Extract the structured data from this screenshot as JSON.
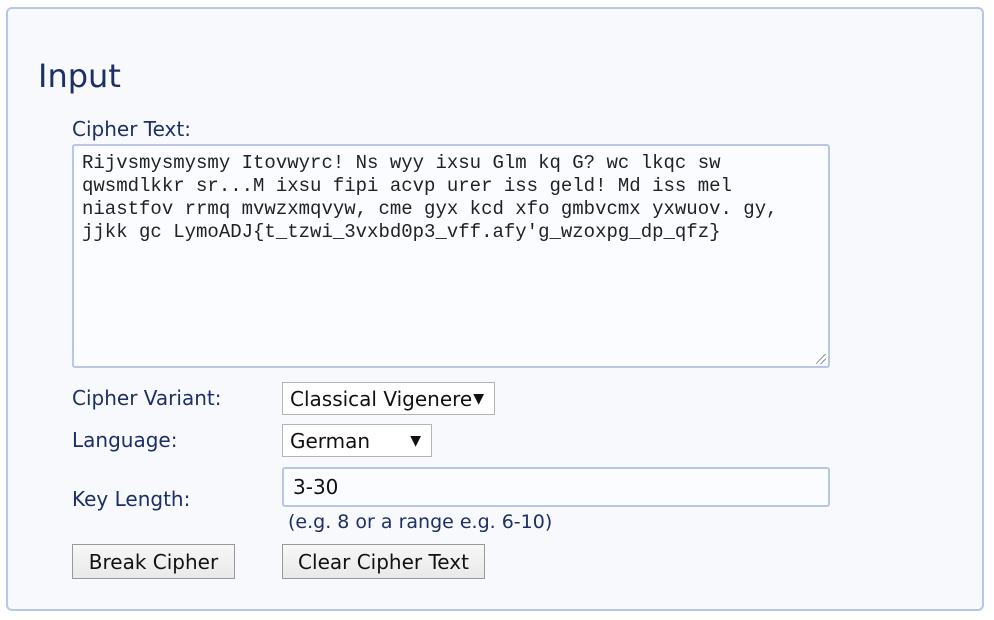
{
  "section": {
    "title": "Input"
  },
  "cipher_text": {
    "label": "Cipher Text:",
    "value": "Rijvsmysmysmy Itovwyrc! Ns wyy ixsu Glm kq G? wc lkqc sw qwsmdlkkr sr...M ixsu fipi acvp urer iss geld! Md iss mel niastfov rrmq mvwzxmqvyw, cme gyx kcd xfo gmbvcmx yxwuov. gy, jjkk gc LymoADJ{t_tzwi_3vxbd0p3_vff.afy'g_wzoxpg_dp_qfz}"
  },
  "cipher_variant": {
    "label": "Cipher Variant:",
    "selected": "Classical Vigenere"
  },
  "language": {
    "label": "Language:",
    "selected": "German"
  },
  "key_length": {
    "label": "Key Length:",
    "value": "3-30",
    "hint": "(e.g. 8 or a range e.g. 6-10)"
  },
  "buttons": {
    "break": "Break Cipher",
    "clear": "Clear Cipher Text"
  },
  "icons": {
    "select_arrow": "triangle-down-icon",
    "resize": "resize-grip-icon"
  },
  "colors": {
    "label": "#1c2f66",
    "border": "#b9c6e6"
  }
}
